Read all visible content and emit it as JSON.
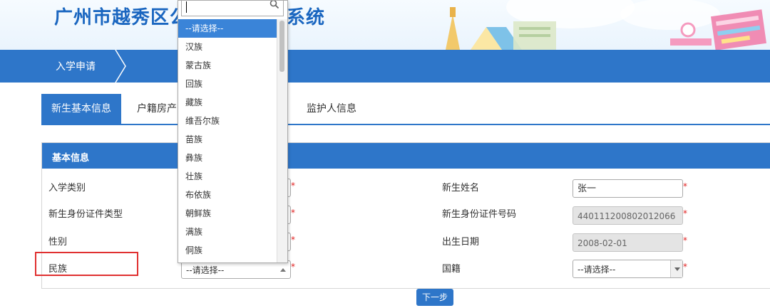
{
  "header": {
    "title_left": "广州市越秀区公",
    "title_right": "系统"
  },
  "nav": {
    "breadcrumb": "入学申请"
  },
  "tabs": [
    {
      "label": "新生基本信息"
    },
    {
      "label": "户籍房产"
    },
    {
      "label": "监护人信息"
    }
  ],
  "panel": {
    "title": "基本信息",
    "left": {
      "admission_type_label": "入学类别",
      "id_type_label": "新生身份证件类型",
      "gender_label": "性别",
      "ethnicity_label": "民族",
      "ethnicity_value": "--请选择--"
    },
    "right": {
      "name_label": "新生姓名",
      "name_value": "张一",
      "id_number_label": "新生身份证件号码",
      "id_number_value": "440111200802012066",
      "birth_label": "出生日期",
      "birth_value": "2008-02-01",
      "nationality_label": "国籍",
      "nationality_value": "--请选择--"
    },
    "required_mark": "*"
  },
  "next_button": "下一步",
  "dropdown": {
    "search_value": "",
    "options": [
      "--请选择--",
      "汉族",
      "蒙古族",
      "回族",
      "藏族",
      "维吾尔族",
      "苗族",
      "彝族",
      "壮族",
      "布依族",
      "朝鲜族",
      "满族",
      "侗族"
    ]
  },
  "colors": {
    "primary": "#2e76c9",
    "selected": "#3a84d8",
    "highlight": "#e03030",
    "required": "#e02020"
  },
  "icons": [
    "search-icon",
    "chevron-right-icon",
    "caret-down-icon",
    "caret-up-icon"
  ]
}
